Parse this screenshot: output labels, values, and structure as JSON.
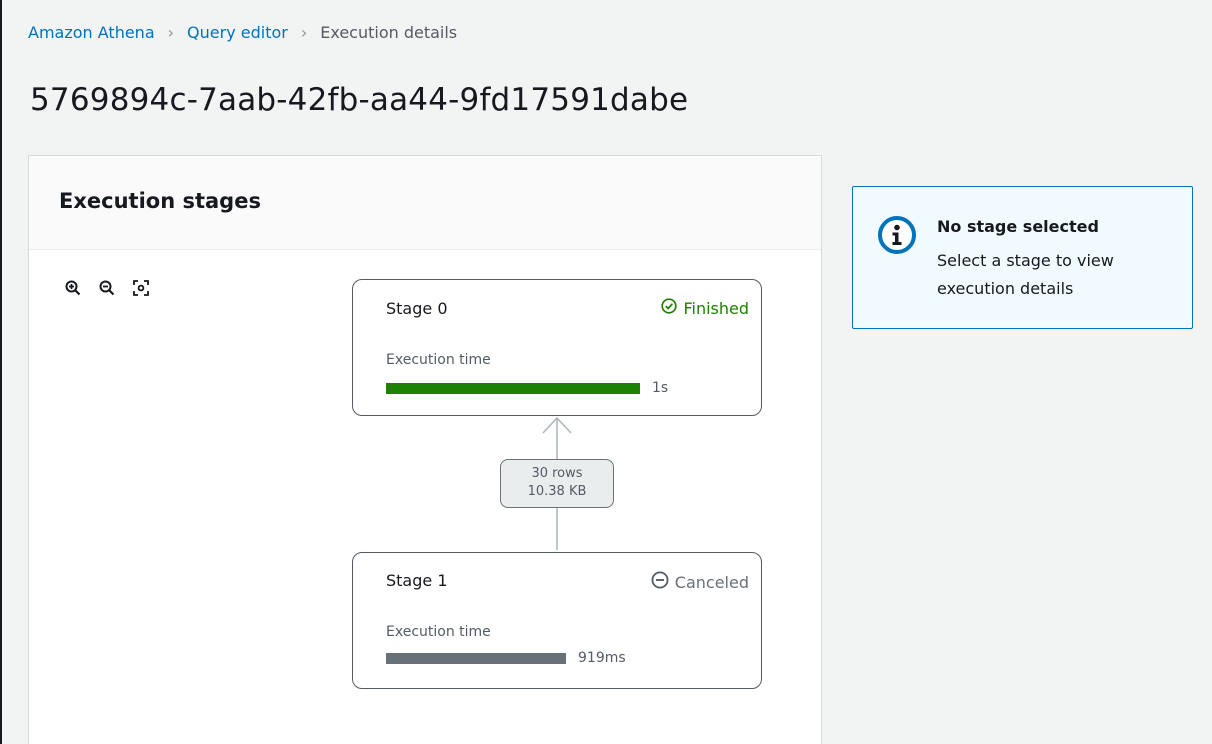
{
  "breadcrumb": {
    "items": [
      "Amazon Athena",
      "Query editor",
      "Execution details"
    ]
  },
  "page_title": "5769894c-7aab-42fb-aa44-9fd17591dabe",
  "stages_panel": {
    "heading": "Execution stages",
    "tools": [
      "zoom-in-icon",
      "zoom-out-icon",
      "fit-to-screen-icon"
    ],
    "stages": [
      {
        "name": "Stage 0",
        "status": "Finished",
        "exec_label": "Execution time",
        "exec_value": "1s",
        "bar_fraction": 1.0,
        "bar_color": "#1d8102"
      },
      {
        "name": "Stage 1",
        "status": "Canceled",
        "exec_label": "Execution time",
        "exec_value": "919ms",
        "bar_fraction": 0.71,
        "bar_color": "#687078"
      }
    ],
    "edge": {
      "rows": "30 rows",
      "size": "10.38 KB"
    }
  },
  "info": {
    "title": "No stage selected",
    "text": "Select a stage to view execution details"
  },
  "colors": {
    "link": "#0073bb",
    "success": "#1d8102",
    "muted": "#687078"
  }
}
